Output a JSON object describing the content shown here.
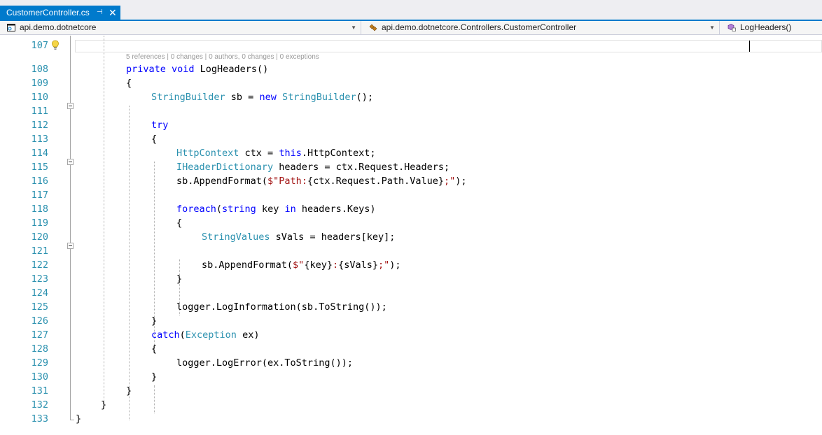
{
  "tab": {
    "title": "CustomerController.cs",
    "pin_glyph": "⊣",
    "close_glyph": "✕"
  },
  "navbar": {
    "project": "api.demo.dotnetcore",
    "class": "api.demo.dotnetcore.Controllers.CustomerController",
    "member": "LogHeaders()",
    "arrow_glyph": "▼"
  },
  "colors": {
    "accent": "#007acc",
    "keyword": "#0000ff",
    "type": "#2b91af",
    "string": "#a31515",
    "line_number": "#2b91af"
  },
  "codelens": {
    "references": "5 references",
    "changes": "0 changes",
    "authors": "0 authors, 0 changes",
    "exceptions": "0 exceptions",
    "separator": " | "
  },
  "icons": [
    "project-icon",
    "class-icon",
    "method-icon",
    "lightbulb-icon",
    "pin-icon",
    "close-icon"
  ],
  "line_numbers": [
    "107",
    "108",
    "109",
    "110",
    "111",
    "112",
    "113",
    "114",
    "115",
    "116",
    "117",
    "118",
    "119",
    "120",
    "121",
    "122",
    "123",
    "124",
    "125",
    "126",
    "127",
    "128",
    "129",
    "130",
    "131",
    "132",
    "133"
  ],
  "code": {
    "l108": {
      "kw": "private void",
      "rest": " LogHeaders()"
    },
    "l109": "{",
    "l110": {
      "t1": "StringBuilder",
      "m1": " sb = ",
      "kw": "new",
      "m2": " ",
      "t2": "StringBuilder",
      "end": "();"
    },
    "l112": "try",
    "l113": "{",
    "l114": {
      "t1": "HttpContext",
      "m1": " ctx = ",
      "kw": "this",
      "end": ".HttpContext;"
    },
    "l115": {
      "t1": "IHeaderDictionary",
      "end": " headers = ctx.Request.Headers;"
    },
    "l116": {
      "pre": "sb.AppendFormat(",
      "s1": "$\"Path:",
      "mid": "{ctx.Request.Path.Value}",
      "s2": ";\"",
      "end": ");"
    },
    "l118": {
      "kw1": "foreach",
      "m1": "(",
      "kw2": "string",
      "m2": " key ",
      "kw3": "in",
      "end": " headers.Keys)"
    },
    "l119": "{",
    "l120": {
      "t1": "StringValues",
      "end": " sVals = headers[key];"
    },
    "l122": {
      "pre": "sb.AppendFormat(",
      "s1": "$\"",
      "m1": "{key}",
      "s2": ":",
      "m2": "{sVals}",
      "s3": ";\"",
      "end": ");"
    },
    "l123": "}",
    "l125": "logger.LogInformation(sb.ToString());",
    "l126": "}",
    "l127": {
      "kw": "catch",
      "m1": "(",
      "t1": "Exception",
      "end": " ex)"
    },
    "l128": "{",
    "l129": "logger.LogError(ex.ToString());",
    "l130": "}",
    "l131": "}",
    "l132": "}",
    "l133": "}"
  }
}
